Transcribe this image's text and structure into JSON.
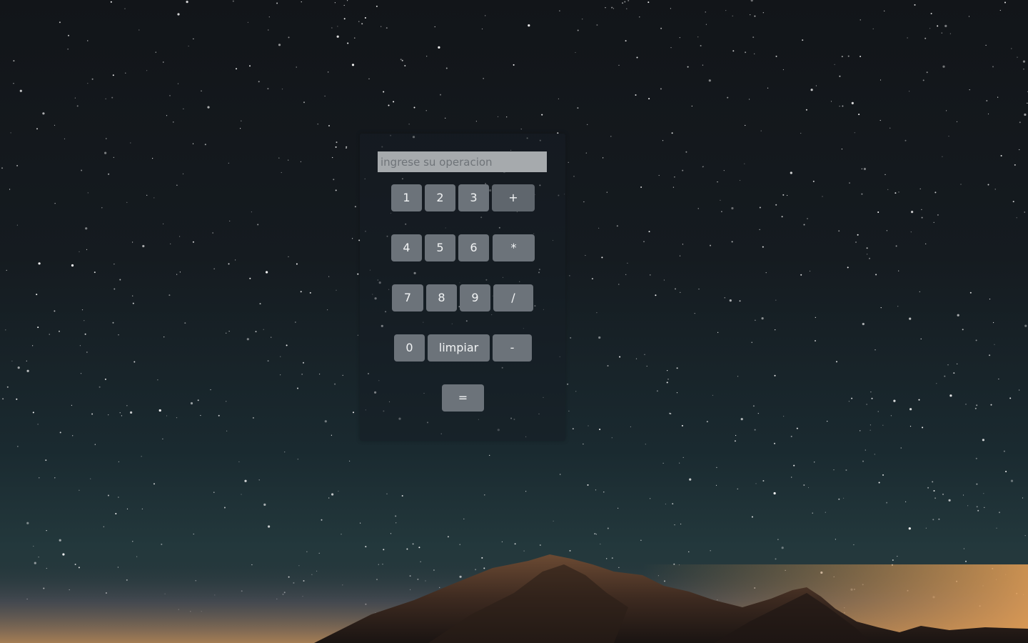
{
  "display": {
    "value": "",
    "placeholder": "ingrese su operacion"
  },
  "keys": {
    "k1": "1",
    "k2": "2",
    "k3": "3",
    "plus": "+",
    "k4": "4",
    "k5": "5",
    "k6": "6",
    "multiply": "*",
    "k7": "7",
    "k8": "8",
    "k9": "9",
    "divide": "/",
    "k0": "0",
    "clear": "limpiar",
    "minus": "-",
    "equals": "="
  },
  "colors": {
    "key_bg": "#6c737a",
    "display_bg": "#a6aaad",
    "panel_bg": "#161e24"
  }
}
